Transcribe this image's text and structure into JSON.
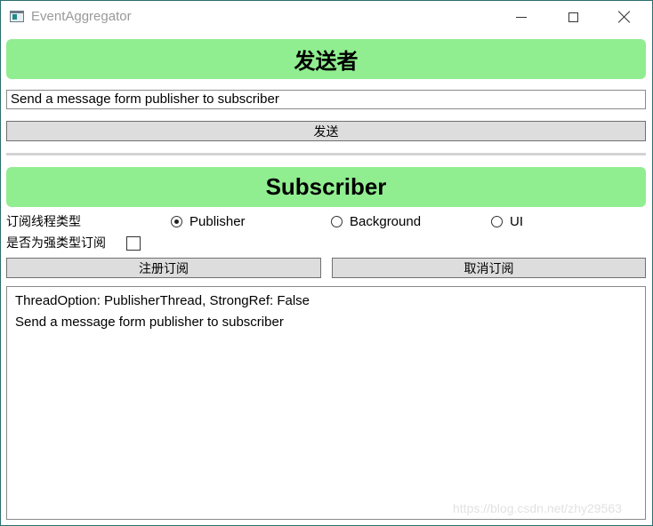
{
  "window": {
    "title": "EventAggregator"
  },
  "sender": {
    "header": "发送者",
    "message_value": "Send a message form publisher to subscriber",
    "send_label": "发送"
  },
  "subscriber": {
    "header": "Subscriber",
    "thread_type_label": "订阅线程类型",
    "thread_options": [
      {
        "label": "Publisher",
        "checked": true
      },
      {
        "label": "Background",
        "checked": false
      },
      {
        "label": "UI",
        "checked": false
      }
    ],
    "strong_ref_label": "是否为强类型订阅",
    "strong_ref_checked": false,
    "register_label": "注册订阅",
    "unsubscribe_label": "取消订阅",
    "log_lines": [
      "ThreadOption: PublisherThread, StrongRef: False",
      "Send a message form publisher to subscriber"
    ]
  },
  "watermark": "https://blog.csdn.net/zhy29563",
  "colors": {
    "banner": "#90ee90",
    "button": "#dddddd",
    "window_border": "#2b6f6f"
  }
}
